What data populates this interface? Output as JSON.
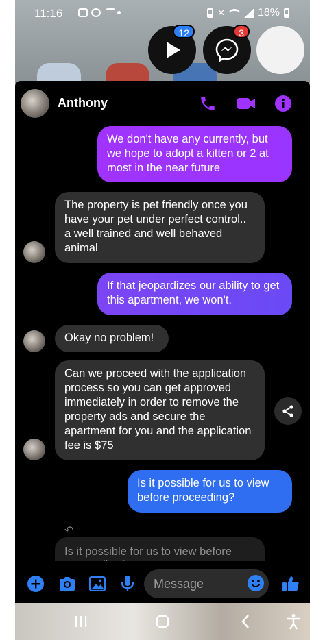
{
  "status_bar": {
    "time": "11:16",
    "battery": "18%"
  },
  "chat_heads": [
    {
      "name": "play-chat-head",
      "badge": "12",
      "badge_color": "#2d7ff9"
    },
    {
      "name": "messenger-chat-head",
      "badge": "3",
      "badge_color": "#e53935"
    },
    {
      "name": "blank-chat-head",
      "badge": ""
    }
  ],
  "header": {
    "contact_name": "Anthony",
    "accent_color": "#a033ff"
  },
  "messages": [
    {
      "direction": "outgoing",
      "text": "We don't have any currently, but we hope to adopt a kitten or 2 at most in the near future"
    },
    {
      "direction": "incoming",
      "text": "The property is pet friendly once you have your pet under perfect control.. a well trained and well behaved animal"
    },
    {
      "direction": "outgoing",
      "text": "If that jeopardizes our ability to get this apartment, we won't."
    },
    {
      "direction": "incoming",
      "text": "Okay no problem!"
    },
    {
      "direction": "incoming",
      "text_before_link": "Can we proceed with the application process so you can get approved immediately in order to remove the property ads and secure the apartment for you and the application fee is ",
      "link_text": "$75"
    },
    {
      "direction": "outgoing",
      "text": "Is it possible for us to view before proceeding?"
    }
  ],
  "reply_preview": {
    "text": "Is it possible for us to view before proceeding?"
  },
  "composer": {
    "placeholder": "Message",
    "accent_color": "#2f7ff5"
  }
}
